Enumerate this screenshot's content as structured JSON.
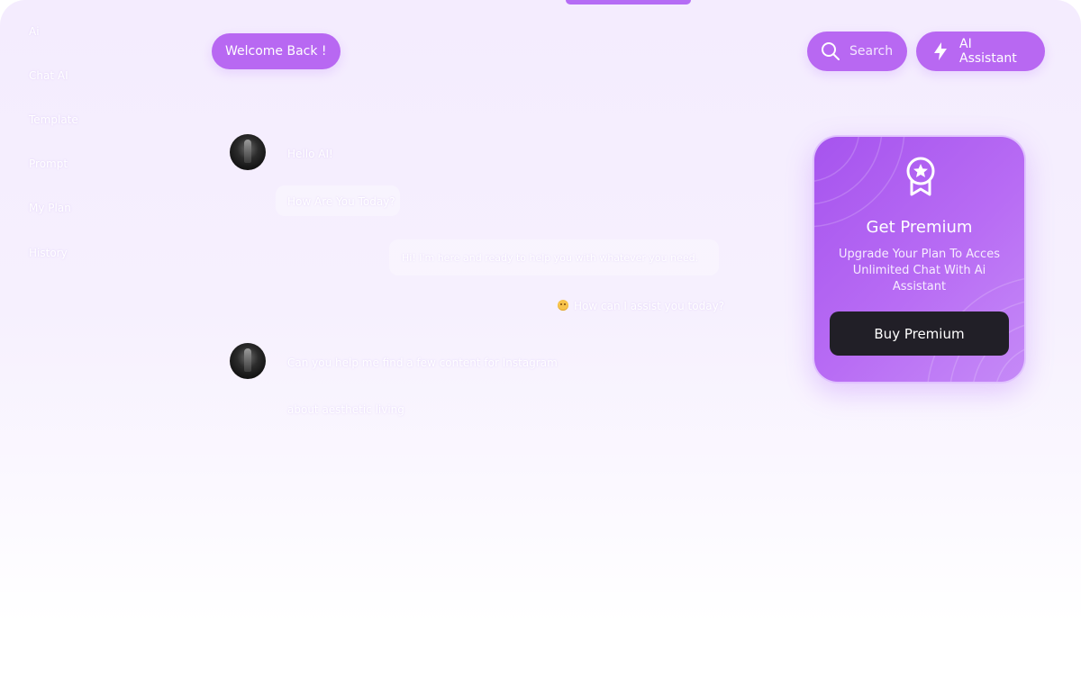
{
  "sidebar": {
    "items": [
      {
        "label": "Ai"
      },
      {
        "label": "Chat AI"
      },
      {
        "label": "Template"
      },
      {
        "label": "Prompt"
      },
      {
        "label": "My Plan"
      },
      {
        "label": "History"
      }
    ]
  },
  "header": {
    "welcome": "Welcome Back !",
    "search_label": "Search",
    "assistant_label": "AI Assistant"
  },
  "chat": {
    "messages": [
      {
        "from": "user",
        "text": "Hello AI!"
      },
      {
        "from": "user",
        "text": "How Are You Today?"
      },
      {
        "from": "ai",
        "text": "Hi! I'm here and ready to help you with whatever you need."
      },
      {
        "from": "ai",
        "text": "How can I assist you today?"
      },
      {
        "from": "user",
        "text": "Can you help me find a few content for Instagram"
      },
      {
        "from": "user",
        "text": "about aesthetic living"
      }
    ]
  },
  "premium": {
    "title": "Get Premium",
    "description": "Upgrade Your Plan To Acces Unlimited Chat With Ai Assistant",
    "button_label": "Buy Premium"
  },
  "icons": {
    "search": "search-icon",
    "assistant": "lightning-icon",
    "premium": "award-badge-icon"
  },
  "colors": {
    "accent": "#b868f2",
    "card": "#a654ee",
    "button_dark": "#211f27",
    "background": "#f4ecfe"
  }
}
